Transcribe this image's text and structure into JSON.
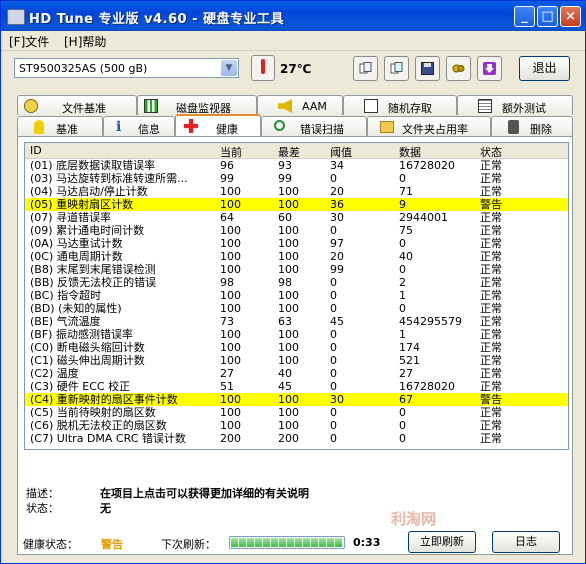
{
  "window": {
    "title": "HD Tune 专业版 v4.60 - 硬盘专业工具",
    "minimize": "_",
    "maximize": "□",
    "close": "×"
  },
  "menu": {
    "file": "[F]文件",
    "help": "[H]帮助"
  },
  "toolbar": {
    "drive": "ST9500325AS (500 gB)",
    "temperature": "27℃",
    "exit_label": "退出",
    "icons": [
      "copy-info-icon",
      "copy-screen-icon",
      "save-icon",
      "options-icon",
      "download-icon"
    ]
  },
  "tabs_top": [
    {
      "label": "文件基准",
      "icon": "file-benchmark-icon"
    },
    {
      "label": "磁盘监视器",
      "icon": "disk-monitor-icon"
    },
    {
      "label": "AAM",
      "icon": "speaker-icon"
    },
    {
      "label": "随机存取",
      "icon": "random-access-icon"
    },
    {
      "label": "额外测试",
      "icon": "extra-tests-icon"
    }
  ],
  "tabs_bottom": [
    {
      "label": "基准",
      "icon": "benchmark-icon"
    },
    {
      "label": "信息",
      "icon": "info-icon"
    },
    {
      "label": "健康",
      "icon": "health-icon",
      "active": true
    },
    {
      "label": "错误扫描",
      "icon": "error-scan-icon"
    },
    {
      "label": "文件夹占用率",
      "icon": "folder-usage-icon"
    },
    {
      "label": "删除",
      "icon": "erase-icon"
    }
  ],
  "grid": {
    "headers": [
      "ID",
      "当前",
      "最差",
      "阈值",
      "数据",
      "状态"
    ],
    "rows": [
      {
        "id": "(01) 底层数据读取错误率",
        "cur": "96",
        "worst": "93",
        "thr": "34",
        "data": "16728020",
        "status": "正常",
        "warn": false
      },
      {
        "id": "(03) 马达旋转到标准转速所需...",
        "cur": "99",
        "worst": "99",
        "thr": "0",
        "data": "0",
        "status": "正常",
        "warn": false
      },
      {
        "id": "(04) 马达启动/停止计数",
        "cur": "100",
        "worst": "100",
        "thr": "20",
        "data": "71",
        "status": "正常",
        "warn": false
      },
      {
        "id": "(05) 重映射扇区计数",
        "cur": "100",
        "worst": "100",
        "thr": "36",
        "data": "9",
        "status": "警告",
        "warn": true
      },
      {
        "id": "(07) 寻道错误率",
        "cur": "64",
        "worst": "60",
        "thr": "30",
        "data": "2944001",
        "status": "正常",
        "warn": false
      },
      {
        "id": "(09) 累计通电时间计数",
        "cur": "100",
        "worst": "100",
        "thr": "0",
        "data": "75",
        "status": "正常",
        "warn": false
      },
      {
        "id": "(0A) 马达重试计数",
        "cur": "100",
        "worst": "100",
        "thr": "97",
        "data": "0",
        "status": "正常",
        "warn": false
      },
      {
        "id": "(0C) 通电周期计数",
        "cur": "100",
        "worst": "100",
        "thr": "20",
        "data": "40",
        "status": "正常",
        "warn": false
      },
      {
        "id": "(B8) 末尾到末尾错误检测",
        "cur": "100",
        "worst": "100",
        "thr": "99",
        "data": "0",
        "status": "正常",
        "warn": false
      },
      {
        "id": "(BB) 反馈无法校正的错误",
        "cur": "98",
        "worst": "98",
        "thr": "0",
        "data": "2",
        "status": "正常",
        "warn": false
      },
      {
        "id": "(BC) 指令超时",
        "cur": "100",
        "worst": "100",
        "thr": "0",
        "data": "1",
        "status": "正常",
        "warn": false
      },
      {
        "id": "(BD) (未知的属性)",
        "cur": "100",
        "worst": "100",
        "thr": "0",
        "data": "0",
        "status": "正常",
        "warn": false
      },
      {
        "id": "(BE) 气流温度",
        "cur": "73",
        "worst": "63",
        "thr": "45",
        "data": "454295579",
        "status": "正常",
        "warn": false
      },
      {
        "id": "(BF) 振动感测错误率",
        "cur": "100",
        "worst": "100",
        "thr": "0",
        "data": "1",
        "status": "正常",
        "warn": false
      },
      {
        "id": "(C0) 断电磁头缩回计数",
        "cur": "100",
        "worst": "100",
        "thr": "0",
        "data": "174",
        "status": "正常",
        "warn": false
      },
      {
        "id": "(C1) 磁头伸出周期计数",
        "cur": "100",
        "worst": "100",
        "thr": "0",
        "data": "521",
        "status": "正常",
        "warn": false
      },
      {
        "id": "(C2) 温度",
        "cur": "27",
        "worst": "40",
        "thr": "0",
        "data": "27",
        "status": "正常",
        "warn": false
      },
      {
        "id": "(C3) 硬件 ECC 校正",
        "cur": "51",
        "worst": "45",
        "thr": "0",
        "data": "16728020",
        "status": "正常",
        "warn": false
      },
      {
        "id": "(C4) 重新映射的扇区事件计数",
        "cur": "100",
        "worst": "100",
        "thr": "30",
        "data": "67",
        "status": "警告",
        "warn": true
      },
      {
        "id": "(C5) 当前待映射的扇区数",
        "cur": "100",
        "worst": "100",
        "thr": "0",
        "data": "0",
        "status": "正常",
        "warn": false
      },
      {
        "id": "(C6) 脱机无法校正的扇区数",
        "cur": "100",
        "worst": "100",
        "thr": "0",
        "data": "0",
        "status": "正常",
        "warn": false
      },
      {
        "id": "(C7) Ultra DMA CRC 错误计数",
        "cur": "200",
        "worst": "200",
        "thr": "0",
        "data": "0",
        "status": "正常",
        "warn": false
      }
    ]
  },
  "details": {
    "desc_label": "描述：",
    "desc_value": "在项目上点击可以获得更加详细的有关说明",
    "state_label": "状态：",
    "state_value": "无"
  },
  "footer": {
    "health_label": "健康状态：",
    "health_value": "警告",
    "health_color": "#E8A000",
    "next_refresh_label": "下次刷新：",
    "countdown": "0:33",
    "refresh_progress": 1.0,
    "refresh_button": "立即刷新",
    "log_button": "日志"
  },
  "watermark": "利淘网"
}
